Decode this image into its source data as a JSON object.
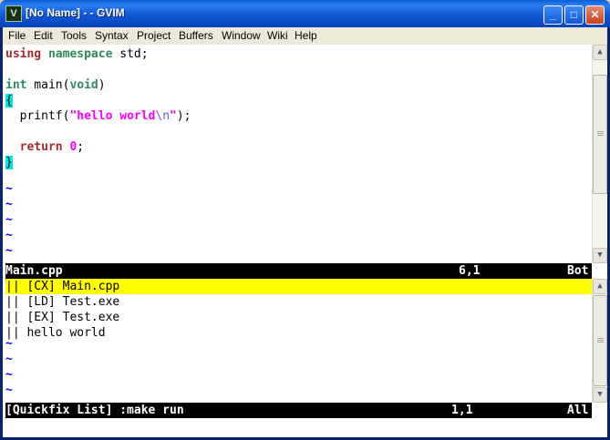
{
  "window": {
    "title": "[No Name] - - GVIM",
    "icon_text": "Vim",
    "buttons": {
      "minimize": "_",
      "maximize": "□",
      "close": "✕"
    }
  },
  "menu": [
    "File",
    "Edit",
    "Tools",
    "Syntax",
    "Project",
    "Buffers",
    "Window",
    "Wiki",
    "Help"
  ],
  "editor": {
    "line1_kw1": "using",
    "line1_kw2": "namespace",
    "line1_rest": " std;",
    "line3_kw": "int",
    "line3_mid": " main(",
    "line3_void": "void",
    "line3_end": ")",
    "line4": "{",
    "line5_pre": "  printf(",
    "line5_str": "\"hello world",
    "line5_esc": "\\n",
    "line5_strend": "\"",
    "line5_end": ");",
    "line7_pre": "  ",
    "line7_kw": "return",
    "line7_sp": " ",
    "line7_num": "0",
    "line7_end": ";",
    "line8": "}",
    "tilde": "~"
  },
  "status_top": {
    "file": "Main.cpp",
    "pos": "6,1",
    "scroll": "Bot"
  },
  "quickfix": {
    "lines": [
      "|| [CX] Main.cpp",
      "|| [LD] Test.exe",
      "|| [EX] Test.exe",
      "|| hello world"
    ]
  },
  "status_bottom": {
    "file": "[Quickfix List] :make run",
    "pos": "1,1",
    "scroll": "All"
  },
  "scroll": {
    "up": "▲",
    "down": "▼"
  }
}
